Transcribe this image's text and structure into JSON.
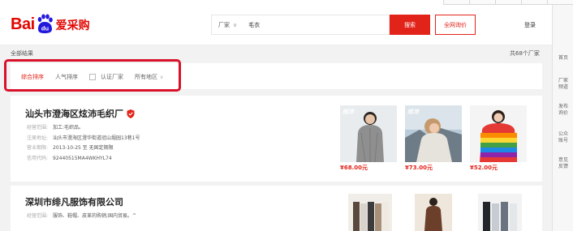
{
  "header": {
    "logo_text": "Bai",
    "logo_du": "du",
    "logo_cn": "爱采购",
    "search_select": "厂家",
    "search_value": "毛衣",
    "search_button": "搜索",
    "inquiry_button": "全网询价",
    "login": "登录"
  },
  "sidebar": {
    "items": [
      {
        "label": "首页"
      },
      {
        "label": "厂家频道"
      },
      {
        "label": "发布询价"
      },
      {
        "label": "公众账号"
      },
      {
        "label": "意见反馈"
      }
    ]
  },
  "results": {
    "all_label": "全部结果",
    "count_label": "共68个厂家"
  },
  "filters": {
    "comprehensive": "综合排序",
    "popular": "人气排序",
    "certified": "认证厂家",
    "region": "所有地区"
  },
  "companies": [
    {
      "name": "汕头市澄海区炫沛毛织厂",
      "fields": [
        {
          "key": "经营范围:",
          "value": "加工:毛织品。"
        },
        {
          "key": "注册地址:",
          "value": "汕头市澄海区澄华街道冠山堀园13巷1号"
        },
        {
          "key": "营业期限:",
          "value": "2013-10-25 至 无固定期限"
        },
        {
          "key": "信用代码:",
          "value": "92440515MA4WKHYL74"
        }
      ],
      "products": [
        {
          "tag": "炫沛",
          "price": "¥68.00元"
        },
        {
          "tag": "炫沛",
          "price": "¥73.00元"
        },
        {
          "tag": "",
          "price": "¥52.00元"
        }
      ]
    },
    {
      "name": "深圳市绯凡服饰有限公司",
      "fields": [
        {
          "key": "经营范围:",
          "value": "服饰、鞋帽、皮革的购销;国内贸易。^"
        }
      ]
    }
  ],
  "colors": {
    "brand_red": "#e2231a",
    "highlight_box": "#d9112a"
  }
}
